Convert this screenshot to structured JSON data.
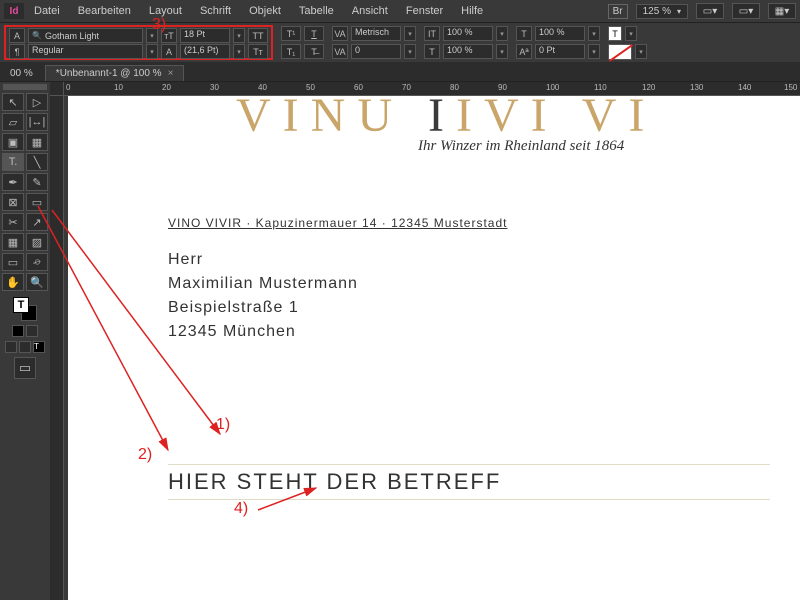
{
  "app": {
    "logo": "Id"
  },
  "menu": {
    "items": [
      "Datei",
      "Bearbeiten",
      "Layout",
      "Schrift",
      "Objekt",
      "Tabelle",
      "Ansicht",
      "Fenster",
      "Hilfe"
    ],
    "br": "Br",
    "zoom": "125 %"
  },
  "control": {
    "font_family": "Gotham Light",
    "font_style": "Regular",
    "font_size": "18 Pt",
    "leading": "(21,6 Pt)",
    "caps1": "TT",
    "caps2": "Tᴛ",
    "icon_a": "A",
    "icon_p": "¶",
    "icon_t": "T",
    "icon_font": "ᴛT",
    "icon_lead": "A",
    "metric": "Metrisch",
    "zero": "0",
    "pct100": "100 %",
    "pt0": "0 Pt"
  },
  "tab": {
    "zoom": "00 %",
    "doc": "*Unbenannt-1 @ 100 %"
  },
  "ruler": [
    "0",
    "10",
    "20",
    "30",
    "40",
    "50",
    "60",
    "70",
    "80",
    "90",
    "100",
    "110",
    "120",
    "130",
    "140",
    "150"
  ],
  "doc": {
    "logo_parts": [
      "VINU ",
      "I",
      "IVI VI"
    ],
    "tagline": "Ihr Winzer im Rheinland seit 1864",
    "sender": "VINO VIVIR · Kapuzinermauer 14 · 12345 Musterstadt",
    "addr_title": "Herr",
    "addr_name": "Maximilian Mustermann",
    "addr_street": "Beispielstraße 1",
    "addr_city": "12345 München",
    "betreff": "HIER STEHT DER BETREFF"
  },
  "anno": {
    "n1": "1)",
    "n2": "2)",
    "n3": "3)",
    "n4": "4)"
  },
  "tools": {
    "arrow": "▾",
    "direct": "▸",
    "page": "⎘",
    "gap": "⧉",
    "type": "T.",
    "line": "╱",
    "pen": "✒",
    "pencil": "✎",
    "rect": "▭",
    "rectframe": "⊠",
    "scissors": "✂",
    "direction": "↗",
    "gradient": "▦",
    "eyedrop": "⌮",
    "hand": "✋",
    "zoom": "🔍",
    "swatch_t": "T",
    "mode1": "▪",
    "mode2": "▫"
  }
}
